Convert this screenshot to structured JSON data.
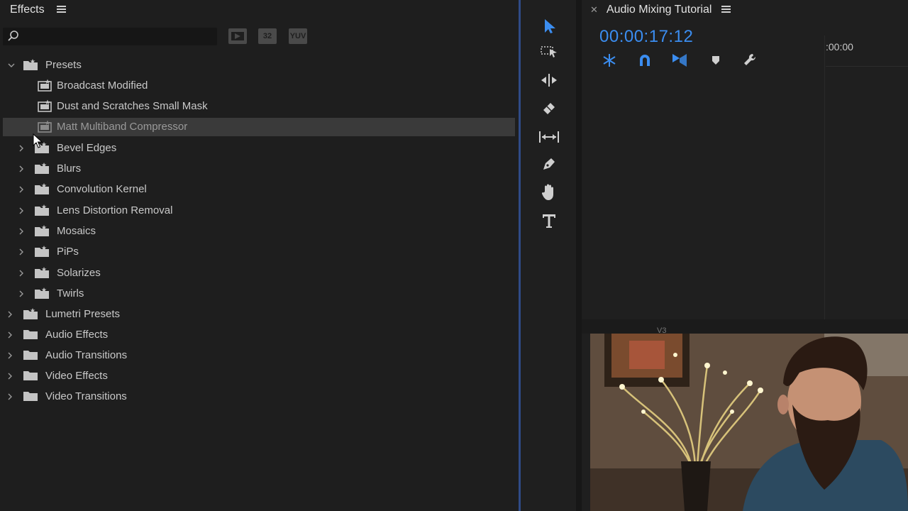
{
  "effects_panel": {
    "title": "Effects",
    "search": {
      "value": "",
      "placeholder": ""
    },
    "filters": [
      {
        "label": "",
        "icon": "accelerated-effects-icon"
      },
      {
        "label": "32",
        "icon": "32bit-color-icon"
      },
      {
        "label": "YUV",
        "icon": "yuv-effects-icon"
      }
    ],
    "tree": [
      {
        "label": "Presets",
        "level": 0,
        "expanded": true,
        "type": "preset-bin"
      },
      {
        "label": "Broadcast Modified",
        "level": 1,
        "type": "preset"
      },
      {
        "label": "Dust and Scratches Small Mask",
        "level": 1,
        "type": "preset"
      },
      {
        "label": "Matt Multiband Compressor",
        "level": 1,
        "type": "preset",
        "selected": true
      },
      {
        "label": "Bevel Edges",
        "level": 1,
        "type": "preset-bin"
      },
      {
        "label": "Blurs",
        "level": 1,
        "type": "preset-bin"
      },
      {
        "label": "Convolution Kernel",
        "level": 1,
        "type": "preset-bin"
      },
      {
        "label": "Lens Distortion Removal",
        "level": 1,
        "type": "preset-bin"
      },
      {
        "label": "Mosaics",
        "level": 1,
        "type": "preset-bin"
      },
      {
        "label": "PiPs",
        "level": 1,
        "type": "preset-bin"
      },
      {
        "label": "Solarizes",
        "level": 1,
        "type": "preset-bin"
      },
      {
        "label": "Twirls",
        "level": 1,
        "type": "preset-bin"
      },
      {
        "label": "Lumetri Presets",
        "level": 0,
        "type": "preset-bin"
      },
      {
        "label": "Audio Effects",
        "level": 0,
        "type": "folder"
      },
      {
        "label": "Audio Transitions",
        "level": 0,
        "type": "folder"
      },
      {
        "label": "Video Effects",
        "level": 0,
        "type": "folder"
      },
      {
        "label": "Video Transitions",
        "level": 0,
        "type": "folder"
      }
    ]
  },
  "tools": [
    {
      "name": "selection-tool",
      "active": true
    },
    {
      "name": "track-select-tool"
    },
    {
      "name": "ripple-edit-tool"
    },
    {
      "name": "razor-tool"
    },
    {
      "name": "slip-tool"
    },
    {
      "name": "pen-tool"
    },
    {
      "name": "hand-tool"
    },
    {
      "name": "type-tool"
    }
  ],
  "timeline": {
    "title": "Audio Mixing Tutorial",
    "timecode": "00:00:17:12",
    "ruler_time": ":00:00",
    "track_label": "V3",
    "controls": [
      {
        "name": "nest-sequence-icon"
      },
      {
        "name": "snap-magnet-icon"
      },
      {
        "name": "linked-selection-icon"
      },
      {
        "name": "add-marker-icon"
      },
      {
        "name": "wrench-settings-icon"
      }
    ]
  },
  "colors": {
    "accent_blue": "#3b8df0",
    "panel_bg": "#1e1e1e",
    "selected_row": "#3a3a3a"
  }
}
